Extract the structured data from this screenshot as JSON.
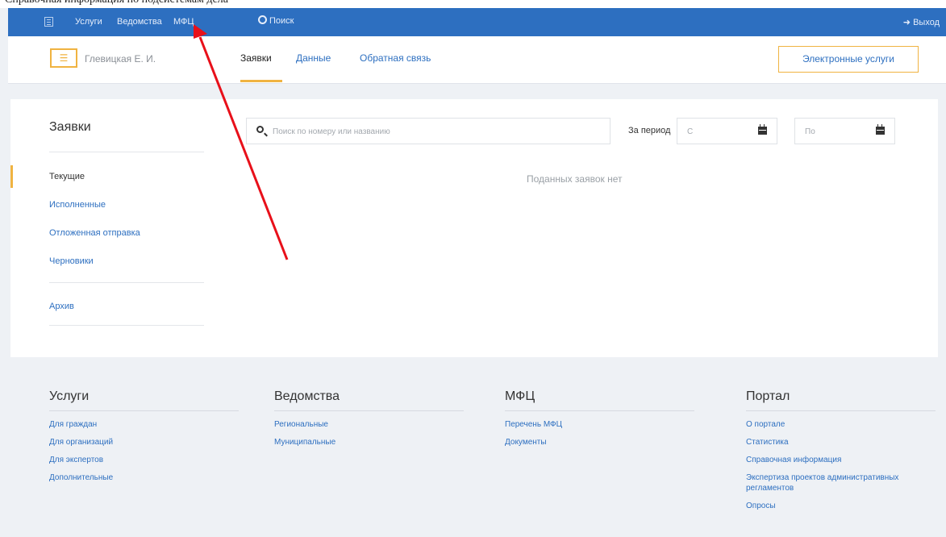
{
  "top_strip_text": "Справочная информация по подсистемам дела",
  "navbar": {
    "links": [
      "Услуги",
      "Ведомства",
      "МФЦ"
    ],
    "search_label": "Поиск",
    "exit_label": "Выход"
  },
  "subheader": {
    "user_name": "Глевицкая Е. И.",
    "tabs": [
      "Заявки",
      "Данные",
      "Обратная связь"
    ],
    "active_tab": "Заявки",
    "eservices_button": "Электронные услуги"
  },
  "sidebar": {
    "title": "Заявки",
    "items": [
      "Текущие",
      "Исполненные",
      "Отложенная отправка",
      "Черновики",
      "Архив"
    ],
    "active_item": "Текущие"
  },
  "filter": {
    "search_placeholder": "Поиск по номеру или названию",
    "period_label": "За период",
    "date_from_placeholder": "С",
    "date_to_placeholder": "По"
  },
  "empty_message": "Поданных заявок нет",
  "footer": [
    {
      "title": "Услуги",
      "links": [
        "Для граждан",
        "Для организаций",
        "Для экспертов",
        "Дополнительные"
      ]
    },
    {
      "title": "Ведомства",
      "links": [
        "Региональные",
        "Муниципальные"
      ]
    },
    {
      "title": "МФЦ",
      "links": [
        "Перечень МФЦ",
        "Документы"
      ]
    },
    {
      "title": "Портал",
      "links": [
        "О портале",
        "Статистика",
        "Справочная информация",
        "Экспертиза проектов административных регламентов",
        "Опросы"
      ]
    }
  ],
  "colors": {
    "navbar": "#2d6fc0",
    "accent": "#f0b341",
    "link": "#2d6fc0",
    "annotation_arrow": "#e8101a"
  }
}
